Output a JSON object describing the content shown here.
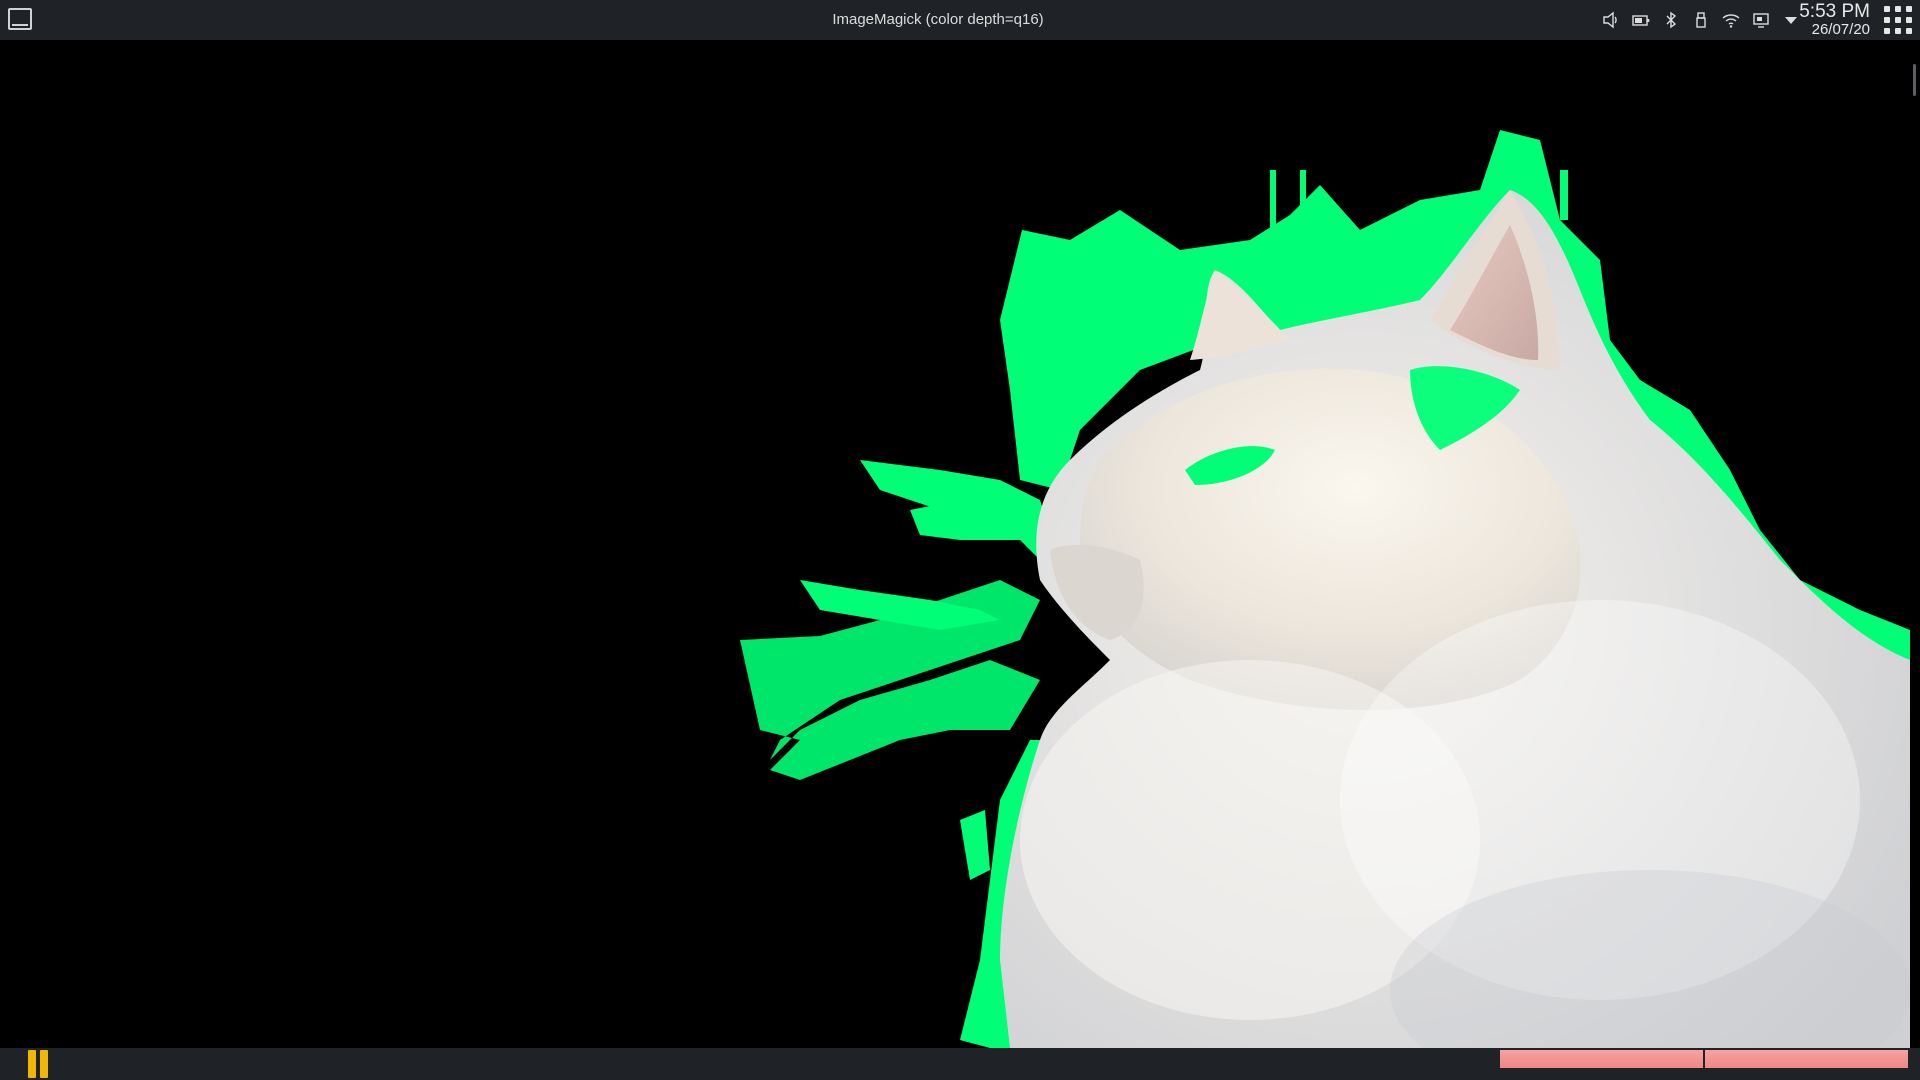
{
  "window": {
    "title": "ImageMagick (color depth=q16)"
  },
  "tray": {
    "icons": [
      "volume-icon",
      "battery-icon",
      "bluetooth-icon",
      "usb-icon",
      "wifi-icon",
      "display-icon",
      "chevron-down-icon"
    ],
    "time": "5:53 PM",
    "date": "26/07/20"
  },
  "image": {
    "subject": "white cat with green fringe on black background"
  },
  "colors": {
    "panel": "#1f2227",
    "accent_green": "#00ff77",
    "pause_yellow": "#f2b705",
    "progress_pink": "#f18686"
  }
}
